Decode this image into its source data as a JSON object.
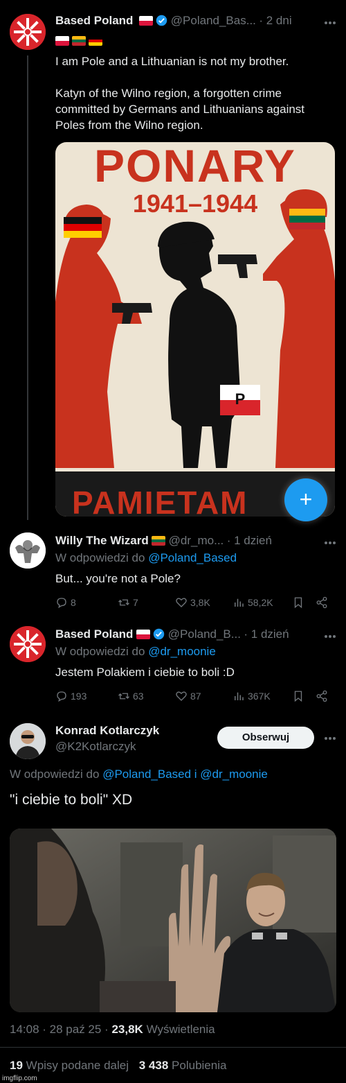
{
  "tweet1": {
    "name": "Based Poland",
    "handle": "@Poland_Bas...",
    "time": "· 2 dni",
    "text1": "I am Pole and a Lithuanian is not my brother.",
    "text2": "Katyn of the Wilno region, a forgotten crime committed by Germans and Lithuanians against Poles from the Wilno region.",
    "poster": {
      "title": "PONARY",
      "years": "1941–1944",
      "bottom": "PAMIETAM"
    }
  },
  "reply1": {
    "name": "Willy The Wizard",
    "handle": "@dr_mo...",
    "time": "· 1 dzień",
    "reply_prefix": "W odpowiedzi do",
    "reply_to": "@Poland_Based",
    "text": "But... you're not a Pole?",
    "replies": "8",
    "reposts": "7",
    "likes": "3,8K",
    "views": "58,2K"
  },
  "reply2": {
    "name": "Based Poland",
    "handle": "@Poland_B...",
    "time": "· 1 dzień",
    "reply_prefix": "W odpowiedzi do",
    "reply_to": "@dr_moonie",
    "text": "Jestem Polakiem i ciebie to boli :D",
    "replies": "193",
    "reposts": "63",
    "likes": "87",
    "views": "367K"
  },
  "main": {
    "name": "Konrad Kotlarczyk",
    "handle": "@K2Kotlarczyk",
    "follow_label": "Obserwuj",
    "reply_prefix": "W odpowiedzi do",
    "reply_to": "@Poland_Based i @dr_moonie",
    "text": "\"i ciebie to boli\" XD",
    "timestamp": "14:08 · 28 paź 25 ·",
    "views_count": "23,8K",
    "views_label": "Wyświetlenia",
    "reposts_count": "19",
    "reposts_label": "Wpisy podane dalej",
    "likes_count": "3 438",
    "likes_label": "Polubienia"
  },
  "fab_label": "+",
  "watermark": "imgflip.com",
  "colors": {
    "background": "#000000",
    "text": "#e7e9ea",
    "muted": "#71767b",
    "accent": "#1d9bf0",
    "poster_red": "#c8321e",
    "poster_bg": "#ede4d3"
  },
  "icons": [
    "reply-icon",
    "repost-icon",
    "like-icon",
    "views-icon",
    "bookmark-icon",
    "share-icon",
    "verified-icon",
    "plus-icon"
  ]
}
